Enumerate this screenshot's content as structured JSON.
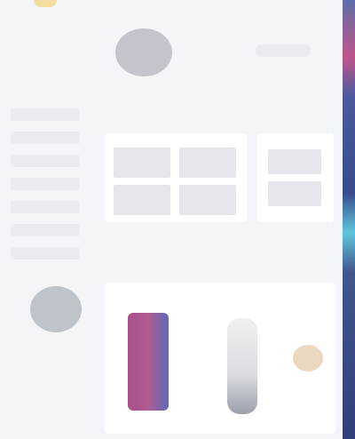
{
  "topbar": {
    "links": [
      "",
      "",
      "",
      ""
    ]
  },
  "sections": {
    "featured_label": "",
    "browse_label": "",
    "popular_label": ""
  },
  "sidebar": {
    "items": [
      "",
      "",
      "",
      "",
      "",
      "",
      ""
    ]
  },
  "cards": {
    "grid_title": "",
    "side_title": ""
  },
  "products": [
    {
      "name": "",
      "colors": [
        "#a7528a",
        "#5a6bb8"
      ]
    },
    {
      "name": "",
      "colors": [
        "#d9dbe0",
        "#9aa0aa"
      ]
    },
    {
      "name": "",
      "colors": [
        "#ead9c0"
      ]
    }
  ],
  "colors": {
    "accent_pink": "#c0558c",
    "accent_cyan": "#5ec6dc",
    "navy": "#3a4b8e",
    "logo_yellow": "#f3dca0"
  }
}
